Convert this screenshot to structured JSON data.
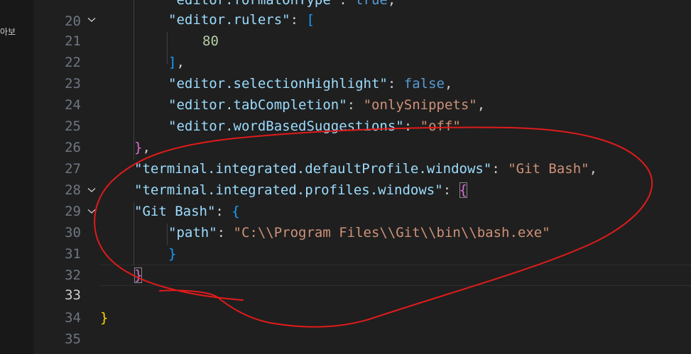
{
  "sidebar": {
    "label": "아보"
  },
  "colors": {
    "background": "#1f1f1f",
    "key": "#9cdcfe",
    "string": "#ce9178",
    "number": "#b5cea8",
    "boolean": "#569cd6",
    "annotation": "#e01b1b"
  },
  "lines": [
    {
      "num": "20",
      "t1": "\"editor.formatOnType\"",
      "t2": ": ",
      "t3": "true",
      "t4": ","
    },
    {
      "num": "21",
      "t1": "\"editor.rulers\"",
      "t2": ": ",
      "t3": "["
    },
    {
      "num": "22",
      "t1": "80"
    },
    {
      "num": "23",
      "t1": "]",
      "t2": ","
    },
    {
      "num": "24",
      "t1": "\"editor.selectionHighlight\"",
      "t2": ": ",
      "t3": "false",
      "t4": ","
    },
    {
      "num": "25",
      "t1": "\"editor.tabCompletion\"",
      "t2": ": ",
      "t3": "\"onlySnippets\"",
      "t4": ","
    },
    {
      "num": "26",
      "t1": "\"editor.wordBasedSuggestions\"",
      "t2": ": ",
      "t3": "\"off\""
    },
    {
      "num": "27",
      "t1": "}",
      "t2": ","
    },
    {
      "num": "28",
      "t1": "\"terminal.integrated.defaultProfile.windows\"",
      "t2": ": ",
      "t3": "\"Git Bash\"",
      "t4": ","
    },
    {
      "num": "29",
      "t1": "\"terminal.integrated.profiles.windows\"",
      "t2": ": ",
      "t3": "{"
    },
    {
      "num": "30",
      "t1": "\"Git Bash\"",
      "t2": ": ",
      "t3": "{"
    },
    {
      "num": "31",
      "t1": "\"path\"",
      "t2": ": ",
      "t3": "\"C:\\\\Program Files\\\\Git\\\\bin\\\\bash.exe\""
    },
    {
      "num": "32",
      "t1": "}"
    },
    {
      "num": "33",
      "t1": "}"
    },
    {
      "num": "34"
    },
    {
      "num": "35",
      "t1": "}"
    }
  ]
}
